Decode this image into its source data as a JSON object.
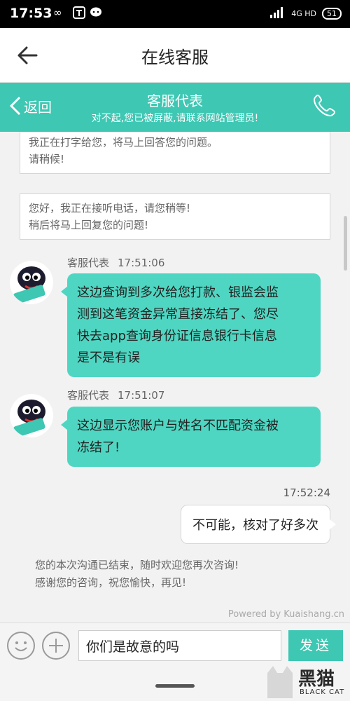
{
  "status_bar": {
    "time": "17:53",
    "icons_left": [
      "infinity-icon",
      "app-icon",
      "chat-icon"
    ],
    "network": "4G HD",
    "battery": "51"
  },
  "app_bar": {
    "title": "在线客服"
  },
  "chat_header": {
    "back_label": "返回",
    "title": "客服代表",
    "subtitle": "对不起,您已被屏蔽,请联系网站管理员!"
  },
  "system_messages": [
    {
      "lines": [
        "我正在打字给您，将马上回答您的问题。",
        "请稍候!"
      ]
    },
    {
      "lines": [
        "您好，我正在接听电话，请您稍等!",
        "稍后将马上回复您的问题!"
      ]
    }
  ],
  "messages": [
    {
      "sender": "客服代表",
      "time": "17:51:06",
      "lines": [
        "这边查询到多次给您打款、银监会监",
        "测到这笔资金异常直接冻结了、您尽",
        "快去app查询身份证信息银行卡信息",
        "是不是有误"
      ]
    },
    {
      "sender": "客服代表",
      "time": "17:51:07",
      "lines": [
        "这边显示您账户与姓名不匹配资金被",
        "冻结了!"
      ]
    }
  ],
  "user_message": {
    "time": "17:52:24",
    "text": "不可能，核对了好多次"
  },
  "end_note": {
    "lines": [
      "您的本次沟通已结束，随时欢迎您再次咨询!",
      "感谢您的咨询，祝您愉快，再见!"
    ]
  },
  "powered_by": "Powered by Kuaishang.cn",
  "input_bar": {
    "value": "你们是故意的吗",
    "send_label": "发送"
  },
  "watermark": {
    "text": "黑猫",
    "sub": "BLACK CAT"
  },
  "colors": {
    "accent": "#3ec7b3",
    "bubble": "#4fd6c2"
  }
}
